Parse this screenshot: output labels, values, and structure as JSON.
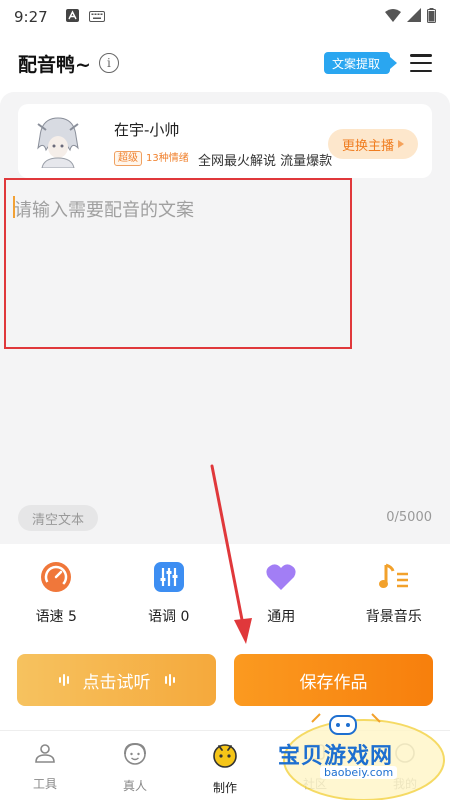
{
  "status_bar": {
    "time": "9:27"
  },
  "header": {
    "title": "配音鸭~",
    "info_icon": "i",
    "extract_label": "文案提取"
  },
  "voice": {
    "name": "在宇-小帅",
    "tag_super": "超级",
    "tag_emotion": "13种情绪",
    "description": "全网最火解说 流量爆款",
    "change_label": "更换主播"
  },
  "editor": {
    "placeholder": "请输入需要配音的文案",
    "clear_label": "清空文本",
    "counter": "0/5000"
  },
  "controls": [
    {
      "label": "语速 5",
      "icon": "speed-gauge-icon",
      "color": "#f0773a"
    },
    {
      "label": "语调 0",
      "icon": "tone-sliders-icon",
      "color": "#3d8ef2"
    },
    {
      "label": "通用",
      "icon": "heart-icon",
      "color": "#a27ef5"
    },
    {
      "label": "背景音乐",
      "icon": "music-note-icon",
      "color": "#f2a12b"
    }
  ],
  "actions": {
    "listen_label": "点击试听",
    "save_label": "保存作品"
  },
  "tabs": [
    {
      "label": "工具",
      "icon": "tools-icon"
    },
    {
      "label": "真人",
      "icon": "real-person-icon"
    },
    {
      "label": "制作",
      "icon": "create-icon",
      "active": true
    },
    {
      "label": "社区",
      "icon": "community-icon"
    },
    {
      "label": "我的",
      "icon": "profile-icon"
    }
  ],
  "watermark": {
    "text": "宝贝游戏网",
    "url": "baobeiy.com"
  },
  "colors": {
    "accent": "#f7870f",
    "blue": "#2aa6f0",
    "highlight": "#e0383b"
  }
}
